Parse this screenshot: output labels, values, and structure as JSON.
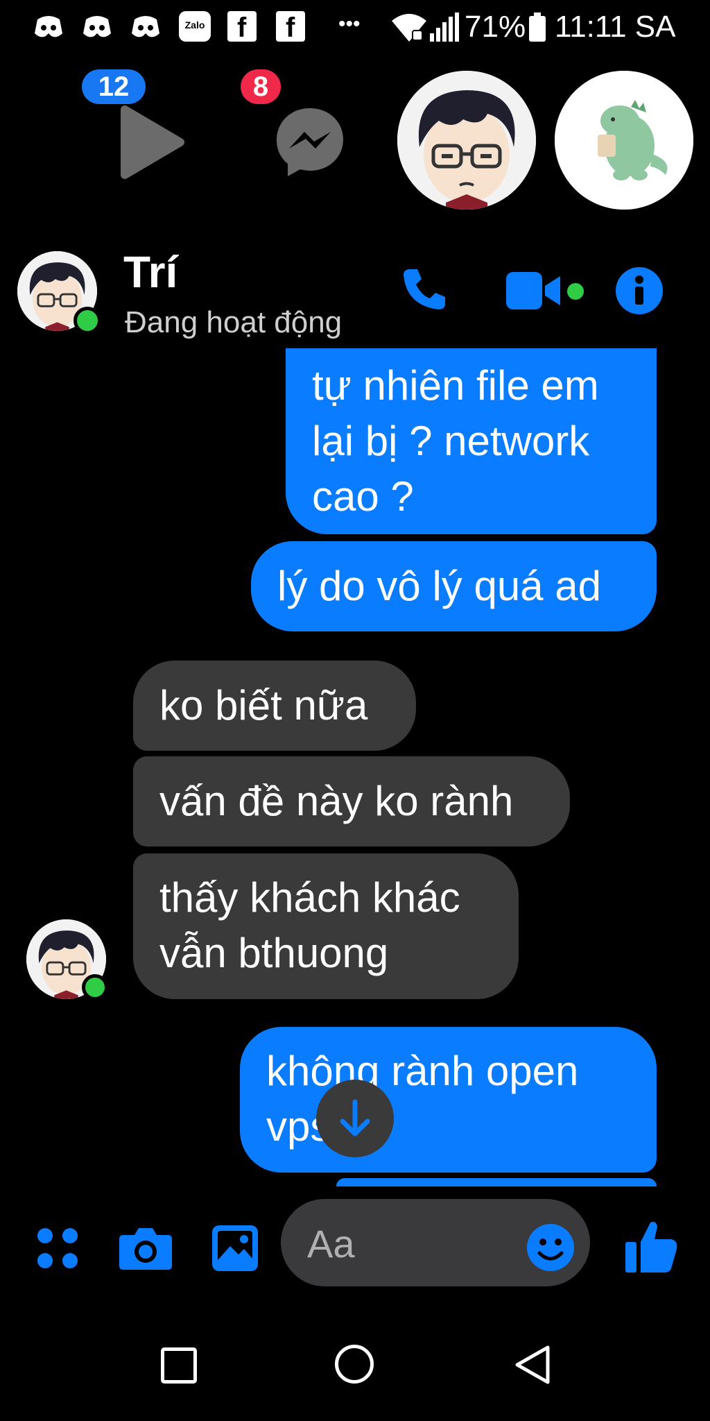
{
  "status_bar": {
    "battery": "71%",
    "time": "11:11 SA",
    "icons": [
      "discord-icon",
      "discord-icon",
      "discord-icon",
      "zalo-icon",
      "facebook-icon",
      "facebook-icon",
      "more-icon",
      "wifi-icon",
      "signal-icon",
      "battery-icon"
    ],
    "zalo_label": "Zalo",
    "more_label": "•••"
  },
  "chat_heads": {
    "video_badge": "12",
    "messenger_badge": "8",
    "colors": {
      "blue_badge": "#1877f2",
      "red_badge": "#f02849"
    }
  },
  "header": {
    "name": "Trí",
    "status": "Đang hoạt động"
  },
  "messages": [
    {
      "side": "out",
      "text_lines": [
        "tự nhiên file em",
        "lại bị ? network",
        "cao ?"
      ]
    },
    {
      "side": "out",
      "text_lines": [
        "lý do vô lý quá ad"
      ]
    },
    {
      "side": "in",
      "text_lines": [
        "ko biết nữa"
      ]
    },
    {
      "side": "in",
      "text_lines": [
        "vấn đề này ko rành"
      ]
    },
    {
      "side": "in",
      "text_lines": [
        "thấy khách khác",
        "vẫn bthuong"
      ]
    },
    {
      "side": "out",
      "text_lines": [
        "không rành open",
        "vps"
      ]
    }
  ],
  "composer": {
    "placeholder": "Aa"
  },
  "colors": {
    "accent": "#0a7cff",
    "incoming_bubble": "#3a3a3a",
    "online": "#31cc46"
  }
}
